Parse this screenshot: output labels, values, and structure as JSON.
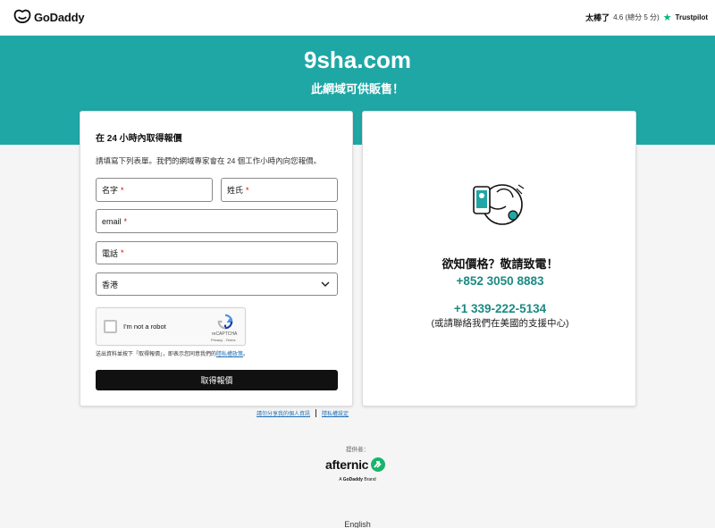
{
  "header": {
    "logo_text": "GoDaddy",
    "rating_word": "太棒了",
    "rating_score": "4.6 (總分 5 分)",
    "trustpilot_label": "Trustpilot"
  },
  "hero": {
    "domain": "9sha.com",
    "subtitle": "此網域可供販售！"
  },
  "form": {
    "title": "在 24 小時內取得報價",
    "description": "請填寫下列表單。我們的網域專家會在 24 個工作小時內向您報價。",
    "first_name_label": "名字",
    "last_name_label": "姓氏",
    "email_label": "email",
    "phone_label": "電話",
    "required_mark": "*",
    "country_value": "香港",
    "captcha_text": "I'm not a robot",
    "captcha_brand": "reCAPTCHA",
    "captcha_links": "Privacy - Terms",
    "consent_prefix": "送出資料並按下「取得報價」，即表示您同意我們的",
    "consent_link": "隱私權政策",
    "consent_suffix": "。",
    "submit_label": "取得報價"
  },
  "contact": {
    "title": "欲知價格？敬請致電！",
    "phone_hk": "+852 3050 8883",
    "phone_us": "+1 339-222-5134",
    "support_note": "(或請聯絡我們在美國的支援中心)"
  },
  "footer": {
    "privacy_share_link": "請勿分享我的個人資訊",
    "privacy_settings_link": "隱私權設定",
    "provided_by": "提供者：",
    "afternic_name": "afternic",
    "brand_line_prefix": "A",
    "brand_line_name": "GoDaddy",
    "brand_line_suffix": "Brand",
    "language": "English"
  },
  "colors": {
    "hero_bg": "#1fa7a6",
    "phone_accent": "#1a8a82",
    "submit_bg": "#111111",
    "trustpilot_green": "#00b67a",
    "afternic_green": "#18b46b"
  },
  "icons": [
    "godaddy-logo-icon",
    "trustpilot-star-icon",
    "chevron-down-icon",
    "recaptcha-icon",
    "phone-call-illustration",
    "afternic-logo-icon"
  ]
}
